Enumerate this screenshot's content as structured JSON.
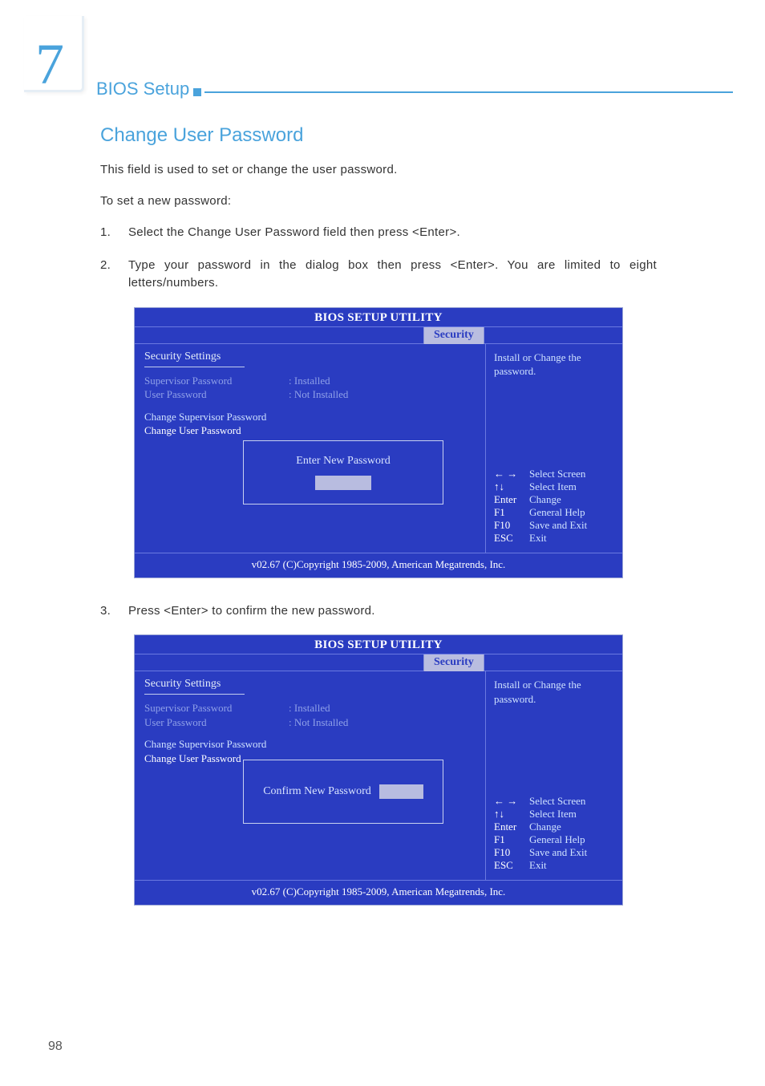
{
  "chapter": {
    "number": "7",
    "title": "BIOS Setup"
  },
  "section_title": "Change User Password",
  "intro": "This field is used to set or change the user password.",
  "subintro": "To set a new password:",
  "steps": {
    "s1": {
      "num": "1.",
      "text": "Select the Change User Password field then press <Enter>."
    },
    "s2": {
      "num": "2.",
      "text": "Type your password in the dialog box then press <Enter>. You are limited to eight letters/numbers."
    },
    "s3": {
      "num": "3.",
      "text": "Press <Enter> to confirm the new password."
    }
  },
  "bios": {
    "utility_title": "BIOS SETUP UTILITY",
    "tab": "Security",
    "section_heading": "Security Settings",
    "rows": {
      "supervisor_label": "Supervisor Password",
      "supervisor_value": ": Installed",
      "user_label": "User Password",
      "user_value": ": Not Installed"
    },
    "menu": {
      "change_supervisor": "Change Supervisor Password",
      "change_user": "Change User Password"
    },
    "dialog1_label": "Enter New Password",
    "dialog2_label": "Confirm New Password",
    "help_text": "Install or Change the password.",
    "nav": {
      "k1": "← →",
      "d1": "Select Screen",
      "k2": "↑↓",
      "d2": "Select Item",
      "k3": "Enter",
      "d3": "Change",
      "k4": "F1",
      "d4": "General Help",
      "k5": "F10",
      "d5": "Save and Exit",
      "k6": "ESC",
      "d6": "Exit"
    },
    "footer": "v02.67 (C)Copyright 1985-2009, American Megatrends, Inc."
  },
  "page_number": "98"
}
